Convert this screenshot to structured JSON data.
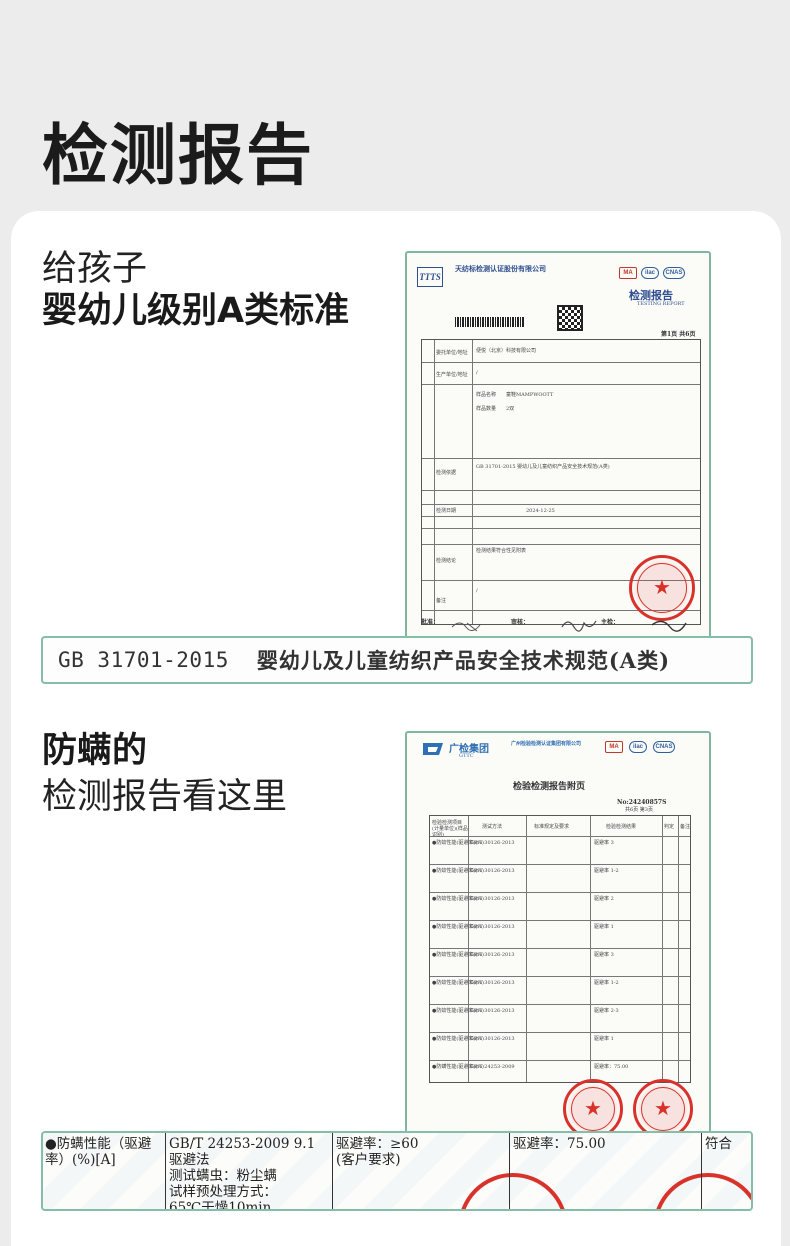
{
  "title": "检测报告",
  "section_a": {
    "line1": "给孩子",
    "line2": "婴幼儿级别A类标准"
  },
  "section_b": {
    "line1": "防螨的",
    "line2": "检测报告看这里"
  },
  "report1": {
    "org_name": "天纺标检测认证股份有限公司",
    "logo_text": "TTTS",
    "doc_title": "检测报告",
    "doc_subtitle": "TESTING REPORT",
    "badges": [
      "MA",
      "ilac",
      "CNAS"
    ],
    "page_info": "第1页 共6页",
    "rows": [
      {
        "label": "委托单位/地址",
        "value": "便悦（北京）科技有限公司"
      },
      {
        "label": "生产单位/地址",
        "value": "/"
      },
      {
        "label": "样品名称",
        "value": "童鞋MAMPWOOTT"
      },
      {
        "label": "样品数量",
        "value": "2双"
      },
      {
        "label": "检测依据",
        "value": "GB 31701-2015 婴幼儿及儿童纺织产品安全技术规范(A类)"
      },
      {
        "label": "检测日期",
        "value": "2024-12-25"
      },
      {
        "label": "检测结论",
        "value": "检测结果符合性见附表"
      },
      {
        "label": "备注",
        "value": "/"
      }
    ],
    "signature_labels": [
      "批准：",
      "审核：",
      "主检："
    ]
  },
  "report2": {
    "org_name": "广州检验检测认证集团有限公司",
    "logo_text": "广检集团",
    "logo_sub": "GTTC",
    "doc_title": "检验检测报告附页",
    "report_no": "No:24240857S",
    "page_info": "共6页 第3页",
    "headers": [
      "检验检测项目(计量单位)(样品识别)",
      "测试方法",
      "标准规定及要求",
      "检验检测结果",
      "判定",
      "备注"
    ],
    "rows": [
      {
        "item": "●防蚊性能(驱避率)(%)",
        "method": "GB/T 30126-2013",
        "result": "驱避率 3"
      },
      {
        "item": "●防蚊性能(驱避率)(%)",
        "method": "GB/T 30126-2013",
        "result": "驱避率 1-2"
      },
      {
        "item": "●防蚊性能(驱避率)(%)",
        "method": "GB/T 30126-2013",
        "result": "驱避率 2"
      },
      {
        "item": "●防蚊性能(驱避率)(%)",
        "method": "GB/T 30126-2013",
        "result": "驱避率 1"
      },
      {
        "item": "●防蚊性能(驱避率)(%)",
        "method": "GB/T 30126-2013",
        "result": "驱避率 3"
      },
      {
        "item": "●防蚊性能(驱避率)(%)",
        "method": "GB/T 30126-2013",
        "result": "驱避率 1-2"
      },
      {
        "item": "●防蚊性能(驱避率)(%)",
        "method": "GB/T 30126-2013",
        "result": "驱避率 2-3"
      },
      {
        "item": "●防蚊性能(驱避率)(%)",
        "method": "GB/T 30126-2013",
        "result": "驱避率 1"
      },
      {
        "item": "●防螨性能(驱避率)(%)",
        "method": "GB/T 24253-2009",
        "result": "驱避率：75.00"
      }
    ]
  },
  "banner1": {
    "code": "GB 31701-2015",
    "name": "婴幼儿及儿童纺织产品安全技术规范(A类)"
  },
  "banner2": {
    "item": "●防螨性能（驱避\n率）(%)[A]",
    "method": "GB/T 24253-2009 9.1\n驱避法\n测试螨虫：粉尘螨\n试样预处理方式：\n65℃干燥10min",
    "requirement": "驱避率：≥60\n(客户要求)",
    "result": "驱避率：75.00",
    "verdict": "符合"
  }
}
